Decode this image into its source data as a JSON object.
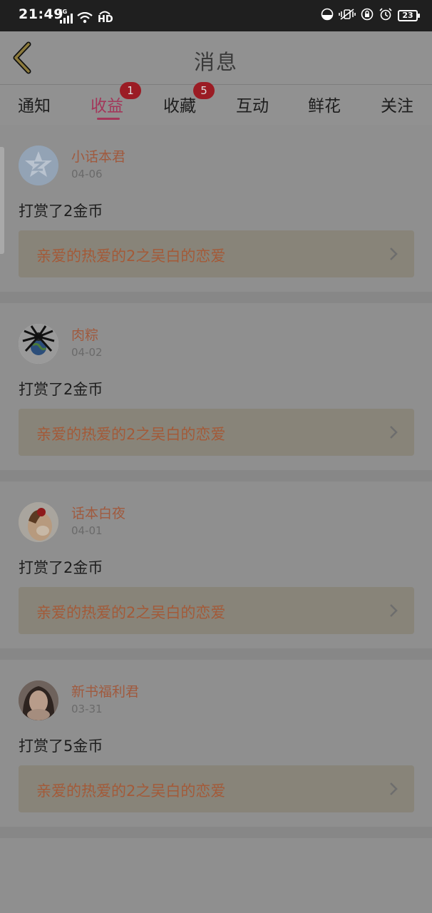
{
  "status_bar": {
    "time": "21:49",
    "network": "4G",
    "hd_label": "HD",
    "battery_level": "23"
  },
  "header": {
    "title": "消息"
  },
  "tabs": [
    {
      "label": "通知",
      "badge": ""
    },
    {
      "label": "收益",
      "badge": "1"
    },
    {
      "label": "收藏",
      "badge": "5"
    },
    {
      "label": "互动",
      "badge": ""
    },
    {
      "label": "鲜花",
      "badge": ""
    },
    {
      "label": "关注",
      "badge": ""
    }
  ],
  "active_tab": "收益",
  "messages": [
    {
      "user": "小话本君",
      "date": "04-06",
      "text": "打赏了2金币",
      "book": "亲爱的热爱的2之吴白的恋爱"
    },
    {
      "user": "肉粽",
      "date": "04-02",
      "text": "打赏了2金币",
      "book": "亲爱的热爱的2之吴白的恋爱"
    },
    {
      "user": "话本白夜",
      "date": "04-01",
      "text": "打赏了2金币",
      "book": "亲爱的热爱的2之吴白的恋爱"
    },
    {
      "user": "新书福利君",
      "date": "03-31",
      "text": "打赏了5金币",
      "book": "亲爱的热爱的2之吴白的恋爱"
    }
  ],
  "colors": {
    "accent": "#a3375a",
    "badge": "#9b1c24",
    "username": "#a05a3e",
    "link_text": "#a35a38",
    "overlay_dim": "#8f8f8f"
  },
  "icons": {
    "back": "chevron-left-icon",
    "link_arrow": "chevron-right-icon"
  }
}
